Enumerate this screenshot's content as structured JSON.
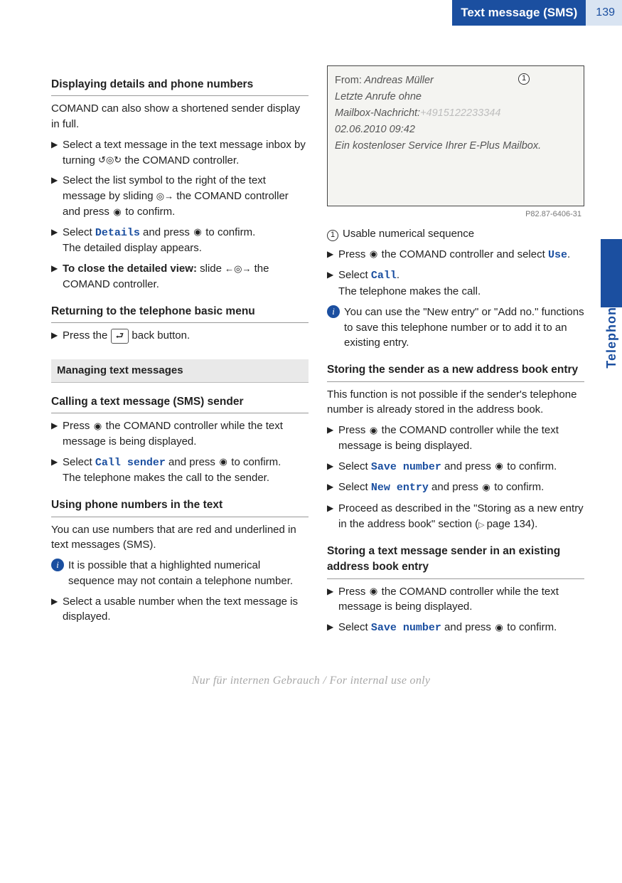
{
  "header": {
    "section_title": "Text message (SMS)",
    "page_no": "139",
    "side_tab": "Telephone"
  },
  "left": {
    "h1": "Displaying details and phone numbers",
    "p1": "COMAND can also show a shortened sender display in full.",
    "s1a": "Select a text message in the text message inbox by turning ",
    "s1b": " the COMAND controller.",
    "s2a": "Select the list symbol to the right of the text message by sliding ",
    "s2b": " the COMAND controller and press ",
    "s2c": " to confirm.",
    "s3a": "Select ",
    "s3ui": "Details",
    "s3b": " and press ",
    "s3c": " to confirm.",
    "s3d": "The detailed display appears.",
    "s4a": "To close the detailed view:",
    "s4b": " slide ",
    "s4c": " the COMAND controller.",
    "h2": "Returning to the telephone basic menu",
    "s5a": "Press the ",
    "s5b": " back button.",
    "bar": "Managing text messages",
    "h3": "Calling a text message (SMS) sender",
    "s6a": "Press ",
    "s6b": " the COMAND controller while the text message is being displayed.",
    "s7a": "Select ",
    "s7ui": "Call sender",
    "s7b": " and press ",
    "s7c": " to confirm.",
    "s7d": "The telephone makes the call to the sender.",
    "h4": "Using phone numbers in the text",
    "p2": "You can use numbers that are red and underlined in text messages (SMS).",
    "i1": "It is possible that a highlighted numerical sequence may not contain a telephone number.",
    "s8": "Select a usable number when the text message is displayed."
  },
  "right": {
    "fig": {
      "from_label": "From:",
      "from_value": "Andreas Müller",
      "line2": "Letzte Anrufe ohne",
      "line3a": "Mailbox-Nachricht:",
      "line3b": "+4915122233344",
      "line4": "02.06.2010 09:42",
      "line5": "Ein kostenloser Service Ihrer E-Plus Mailbox.",
      "caption": "P82.87-6406-31",
      "callout": "1"
    },
    "cap1": "Usable numerical sequence",
    "s1a": "Press ",
    "s1b": " the COMAND controller and select ",
    "s1ui": "Use",
    "s1c": ".",
    "s2a": "Select ",
    "s2ui": "Call",
    "s2b": ".",
    "s2c": "The telephone makes the call.",
    "i1": "You can use the \"New entry\" or \"Add no.\" functions to save this telephone number or to add it to an existing entry.",
    "h2": "Storing the sender as a new address book entry",
    "p1": "This function is not possible if the sender's telephone number is already stored in the address book.",
    "s3a": "Press ",
    "s3b": " the COMAND controller while the text message is being displayed.",
    "s4a": "Select ",
    "s4ui": "Save number",
    "s4b": " and press ",
    "s4c": " to confirm.",
    "s5a": "Select ",
    "s5ui": "New entry",
    "s5b": " and press ",
    "s5c": " to confirm.",
    "s6a": "Proceed as described in the \"Storing as a new entry in the address book\" section (",
    "s6b": "page 134).",
    "h3": "Storing a text message sender in an existing address book entry",
    "s7a": "Press ",
    "s7b": " the COMAND controller while the text message is being displayed.",
    "s8a": "Select ",
    "s8ui": "Save number",
    "s8b": " and press ",
    "s8c": " to confirm."
  },
  "footer": "Nur für internen Gebrauch / For internal use only",
  "glyphs": {
    "turn": "↺◎↻",
    "slide_right": "◎→",
    "slide_both": "←◎→",
    "press": "◉",
    "back": "⮐"
  }
}
